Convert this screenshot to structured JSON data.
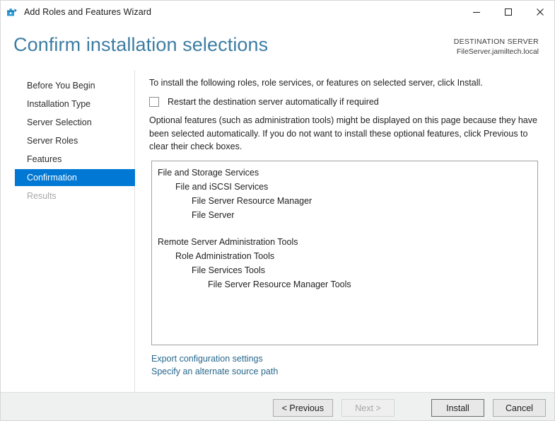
{
  "window": {
    "title": "Add Roles and Features Wizard",
    "icon": "wizard-toolbox-icon",
    "controls": {
      "minimize": "minimize-icon",
      "maximize": "maximize-icon",
      "close": "close-icon"
    }
  },
  "header": {
    "page_title": "Confirm installation selections",
    "destination_label": "DESTINATION SERVER",
    "destination_server": "FileServer.jamiltech.local",
    "title_color": "#3d7da3"
  },
  "sidebar": {
    "items": [
      {
        "label": "Before You Begin",
        "state": "normal"
      },
      {
        "label": "Installation Type",
        "state": "normal"
      },
      {
        "label": "Server Selection",
        "state": "normal"
      },
      {
        "label": "Server Roles",
        "state": "normal"
      },
      {
        "label": "Features",
        "state": "normal"
      },
      {
        "label": "Confirmation",
        "state": "selected"
      },
      {
        "label": "Results",
        "state": "disabled"
      }
    ],
    "selected_color": "#0078d4"
  },
  "content": {
    "intro": "To install the following roles, role services, or features on selected server, click Install.",
    "restart_checkbox": {
      "label": "Restart the destination server automatically if required",
      "checked": false
    },
    "optional_note": "Optional features (such as administration tools) might be displayed on this page because they have been selected automatically. If you do not want to install these optional features, click Previous to clear their check boxes.",
    "selections": [
      {
        "label": "File and Storage Services",
        "level": 0
      },
      {
        "label": "File and iSCSI Services",
        "level": 1
      },
      {
        "label": "File Server Resource Manager",
        "level": 2
      },
      {
        "label": "File Server",
        "level": 2
      },
      {
        "label": "",
        "level": -1
      },
      {
        "label": "Remote Server Administration Tools",
        "level": 0
      },
      {
        "label": "Role Administration Tools",
        "level": 1
      },
      {
        "label": "File Services Tools",
        "level": 2
      },
      {
        "label": "File Server Resource Manager Tools",
        "level": 3
      }
    ],
    "links": [
      "Export configuration settings",
      "Specify an alternate source path"
    ],
    "link_color": "#28688c"
  },
  "footer": {
    "buttons": [
      {
        "label": "< Previous",
        "state": "normal"
      },
      {
        "label": "Next >",
        "state": "disabled"
      },
      {
        "label": "Install",
        "state": "default"
      },
      {
        "label": "Cancel",
        "state": "normal"
      }
    ]
  }
}
